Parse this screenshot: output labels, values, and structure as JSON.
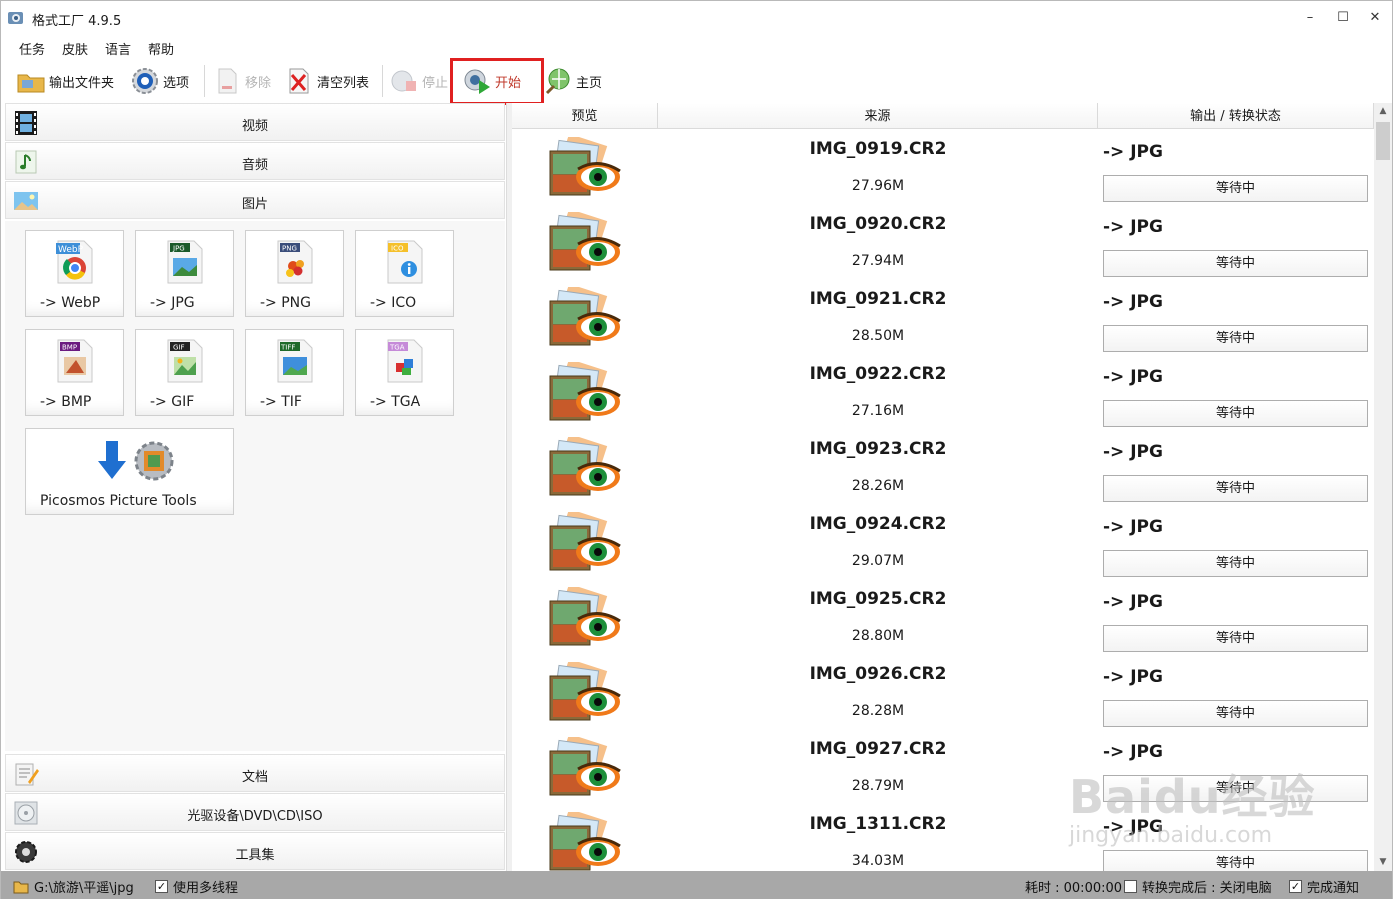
{
  "window": {
    "title": "格式工厂 4.9.5",
    "controls": {
      "minimize": "–",
      "maximize": "☐",
      "close": "✕"
    }
  },
  "menu": [
    "任务",
    "皮肤",
    "语言",
    "帮助"
  ],
  "toolbar": {
    "output_folder": "输出文件夹",
    "options": "选项",
    "remove": "移除",
    "clear_list": "清空列表",
    "stop": "停止",
    "start": "开始",
    "home": "主页"
  },
  "categories": {
    "video": "视频",
    "audio": "音频",
    "picture": "图片",
    "document": "文档",
    "optical": "光驱设备\\DVD\\CD\\ISO",
    "tools": "工具集"
  },
  "picture_tiles": [
    {
      "label": "-> WebP",
      "badge": "WebP",
      "icon": "webp-icon"
    },
    {
      "label": "-> JPG",
      "badge": "JPG",
      "icon": "jpg-icon"
    },
    {
      "label": "-> PNG",
      "badge": "PNG",
      "icon": "png-icon"
    },
    {
      "label": "-> ICO",
      "badge": "ICO",
      "icon": "ico-icon"
    },
    {
      "label": "-> BMP",
      "badge": "BMP",
      "icon": "bmp-icon"
    },
    {
      "label": "-> GIF",
      "badge": "GIF",
      "icon": "gif-icon"
    },
    {
      "label": "-> TIF",
      "badge": "TIFF",
      "icon": "tiff-icon"
    },
    {
      "label": "-> TGA",
      "badge": "TGA",
      "icon": "tga-icon"
    }
  ],
  "picture_tools": {
    "label": "Picosmos Picture Tools",
    "icon": "picosmos-icon"
  },
  "columns": {
    "preview": "预览",
    "source": "来源",
    "status": "输出 / 转换状态"
  },
  "tasks": [
    {
      "file": "IMG_0919.CR2",
      "size": "27.96M",
      "target": "-> JPG",
      "status": "等待中"
    },
    {
      "file": "IMG_0920.CR2",
      "size": "27.94M",
      "target": "-> JPG",
      "status": "等待中"
    },
    {
      "file": "IMG_0921.CR2",
      "size": "28.50M",
      "target": "-> JPG",
      "status": "等待中"
    },
    {
      "file": "IMG_0922.CR2",
      "size": "27.16M",
      "target": "-> JPG",
      "status": "等待中"
    },
    {
      "file": "IMG_0923.CR2",
      "size": "28.26M",
      "target": "-> JPG",
      "status": "等待中"
    },
    {
      "file": "IMG_0924.CR2",
      "size": "29.07M",
      "target": "-> JPG",
      "status": "等待中"
    },
    {
      "file": "IMG_0925.CR2",
      "size": "28.80M",
      "target": "-> JPG",
      "status": "等待中"
    },
    {
      "file": "IMG_0926.CR2",
      "size": "28.28M",
      "target": "-> JPG",
      "status": "等待中"
    },
    {
      "file": "IMG_0927.CR2",
      "size": "28.79M",
      "target": "-> JPG",
      "status": "等待中"
    },
    {
      "file": "IMG_1311.CR2",
      "size": "34.03M",
      "target": "-> JPG",
      "status": "等待中"
    }
  ],
  "statusbar": {
    "output_path": "G:\\旅游\\平遥\\jpg",
    "multithread_label": "使用多线程",
    "multithread_checked": true,
    "elapsed": "耗时 : 00:00:00",
    "after_label": "转换完成后 : 关闭电脑",
    "after_checked": false,
    "notify_label": "完成通知",
    "notify_checked": true
  },
  "watermark": {
    "main": "Baidu经验",
    "sub": "jingyan.baidu.com"
  },
  "colors": {
    "highlight": "#e02020",
    "statusbar": "#a8a8a8"
  }
}
